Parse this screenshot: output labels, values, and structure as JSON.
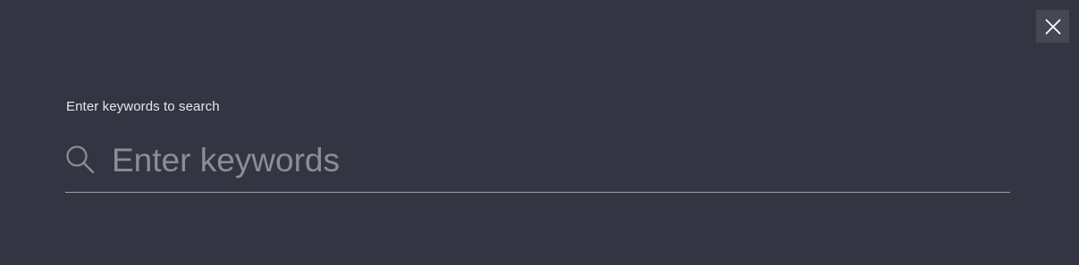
{
  "close_button": {
    "icon": "close-icon",
    "aria_label": "Close"
  },
  "search": {
    "label": "Enter keywords to search",
    "placeholder": "Enter keywords",
    "value": "",
    "icon": "search-icon"
  },
  "colors": {
    "background": "#343542",
    "close_button_bg": "#454753",
    "label_text": "#e6e7ec",
    "placeholder_text": "#8b8d98",
    "underline": "#9fa1ab"
  }
}
